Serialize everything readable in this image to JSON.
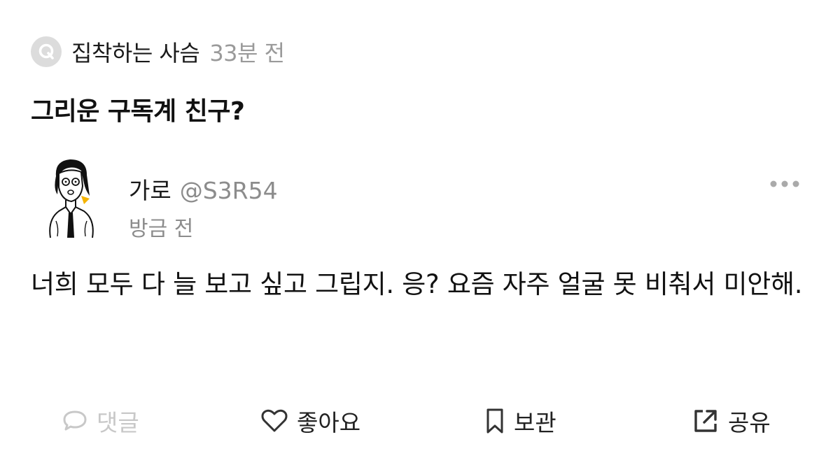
{
  "question": {
    "author": "집착하는 사슴",
    "time": "33분 전",
    "title": "그리운 구독계 친구?"
  },
  "answer": {
    "user_name": "가로",
    "user_handle": "@S3R54",
    "time": "방금 전",
    "body": "너희 모두 다 늘 보고 싶고 그립지. 응? 요즘 자주 얼굴 못 비춰서 미안해."
  },
  "actions": {
    "comment": "댓글",
    "like": "좋아요",
    "save": "보관",
    "share": "공유"
  },
  "icons": {
    "question_badge": "q-badge-icon",
    "more": "more-dots-icon",
    "comment": "comment-bubble-icon",
    "like": "heart-icon",
    "save": "bookmark-icon",
    "share": "share-external-icon"
  },
  "colors": {
    "badge_bg": "#dcdcdc",
    "muted_text": "#8c8c8c",
    "disabled_action": "#c8c8c8",
    "avatar_accent": "#f5b400"
  }
}
